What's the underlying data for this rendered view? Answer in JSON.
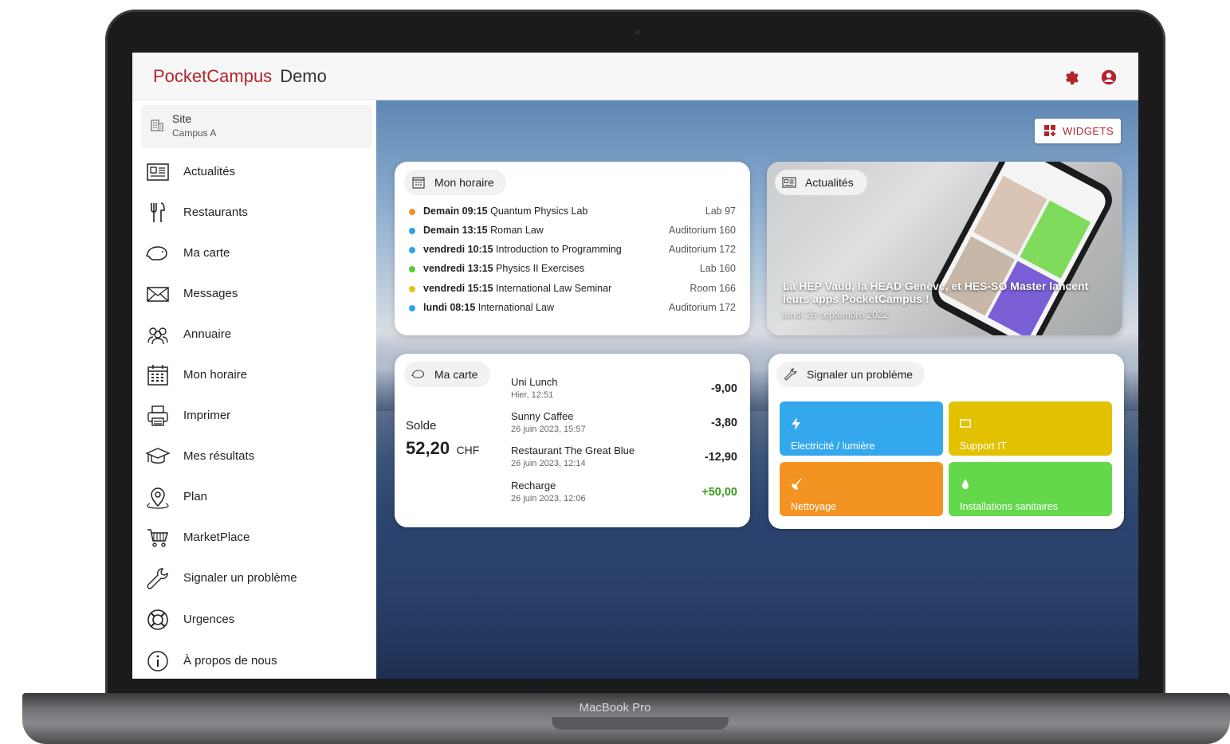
{
  "device": {
    "label": "MacBook Pro"
  },
  "topbar": {
    "brand": "PocketCampus",
    "subtitle": "Demo",
    "icons": [
      "gear-icon",
      "user-icon"
    ]
  },
  "sidebar": {
    "site": {
      "label": "Site",
      "value": "Campus A"
    },
    "items": [
      {
        "label": "Actualités",
        "icon": "newspaper-icon"
      },
      {
        "label": "Restaurants",
        "icon": "cutlery-icon"
      },
      {
        "label": "Ma carte",
        "icon": "piggy-bank-icon"
      },
      {
        "label": "Messages",
        "icon": "envelope-icon"
      },
      {
        "label": "Annuaire",
        "icon": "people-icon"
      },
      {
        "label": "Mon horaire",
        "icon": "calendar-icon"
      },
      {
        "label": "Imprimer",
        "icon": "printer-icon"
      },
      {
        "label": "Mes résultats",
        "icon": "graduation-cap-icon"
      },
      {
        "label": "Plan",
        "icon": "map-pin-icon"
      },
      {
        "label": "MarketPlace",
        "icon": "cart-icon"
      },
      {
        "label": "Signaler un problème",
        "icon": "wrench-icon"
      },
      {
        "label": "Urgences",
        "icon": "lifebuoy-icon"
      },
      {
        "label": "À propos de nous",
        "icon": "info-icon"
      }
    ]
  },
  "main": {
    "widgets_button": "WIDGETS",
    "schedule": {
      "title": "Mon horaire",
      "rows": [
        {
          "when": "Demain 09:15",
          "course": "Quantum Physics Lab",
          "room": "Lab 97",
          "color": "#f0932b"
        },
        {
          "when": "Demain 13:15",
          "course": "Roman Law",
          "room": "Auditorium 160",
          "color": "#2fa3e6"
        },
        {
          "when": "vendredi 10:15",
          "course": "Introduction to Programming",
          "room": "Auditorium 172",
          "color": "#2fa3e6"
        },
        {
          "when": "vendredi 13:15",
          "course": "Physics II Exercises",
          "room": "Lab 160",
          "color": "#5ccb3a"
        },
        {
          "when": "vendredi 15:15",
          "course": "International Law Seminar",
          "room": "Room 166",
          "color": "#e6c31a"
        },
        {
          "when": "lundi 08:15",
          "course": "International Law",
          "room": "Auditorium 172",
          "color": "#2fa3e6"
        }
      ]
    },
    "news": {
      "title": "Actualités",
      "headline": "La HEP Vaud, la HEAD Genève, et HES-SO Master lancent leurs apps PocketCampus !",
      "date": "lundi 26 septembre 2022"
    },
    "card": {
      "title": "Ma carte",
      "balance_label": "Solde",
      "balance": "52,20",
      "currency": "CHF",
      "transactions": [
        {
          "name": "Uni Lunch",
          "date": "Hier, 12:51",
          "amount": "-9,00",
          "positive": false
        },
        {
          "name": "Sunny Caffee",
          "date": "26 juin 2023, 15:57",
          "amount": "-3,80",
          "positive": false
        },
        {
          "name": "Restaurant The Great Blue",
          "date": "26 juin 2023, 12:14",
          "amount": "-12,90",
          "positive": false
        },
        {
          "name": "Recharge",
          "date": "26 juin 2023, 12:06",
          "amount": "+50,00",
          "positive": true
        }
      ]
    },
    "report": {
      "title": "Signaler un problème",
      "tiles": [
        {
          "label": "Electricité / lumière",
          "color": "#33a8ec",
          "icon": "bolt-icon"
        },
        {
          "label": "Support IT",
          "color": "#e2c200",
          "icon": "monitor-icon"
        },
        {
          "label": "Nettoyage",
          "color": "#f39422",
          "icon": "broom-icon"
        },
        {
          "label": "Installations sanitaires",
          "color": "#62d84a",
          "icon": "droplet-icon"
        }
      ]
    }
  },
  "colors": {
    "brand": "#b3242b"
  }
}
